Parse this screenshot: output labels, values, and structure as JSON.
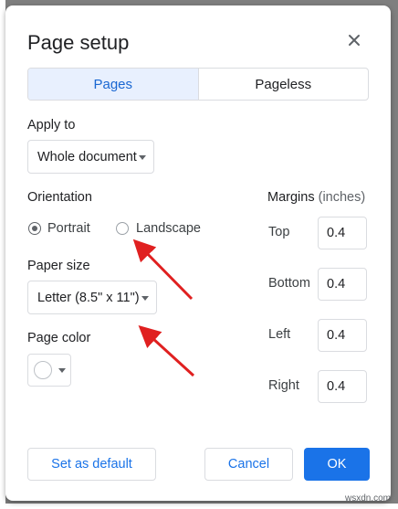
{
  "dialog": {
    "title": "Page setup",
    "tabs": [
      {
        "label": "Pages",
        "active": true
      },
      {
        "label": "Pageless",
        "active": false
      }
    ],
    "apply_to": {
      "label": "Apply to",
      "value": "Whole document"
    },
    "orientation": {
      "label": "Orientation",
      "options": [
        {
          "label": "Portrait",
          "selected": true
        },
        {
          "label": "Landscape",
          "selected": false
        }
      ]
    },
    "paper_size": {
      "label": "Paper size",
      "value": "Letter (8.5\" x 11\")"
    },
    "page_color": {
      "label": "Page color",
      "value": "#ffffff"
    },
    "margins": {
      "label": "Margins",
      "unit": "(inches)",
      "fields": [
        {
          "label": "Top",
          "value": "0.4"
        },
        {
          "label": "Bottom",
          "value": "0.4"
        },
        {
          "label": "Left",
          "value": "0.4"
        },
        {
          "label": "Right",
          "value": "0.4"
        }
      ]
    },
    "buttons": {
      "set_default": "Set as default",
      "cancel": "Cancel",
      "ok": "OK"
    }
  },
  "annotation_color": "#e02020",
  "watermark": "wsxdn.com"
}
